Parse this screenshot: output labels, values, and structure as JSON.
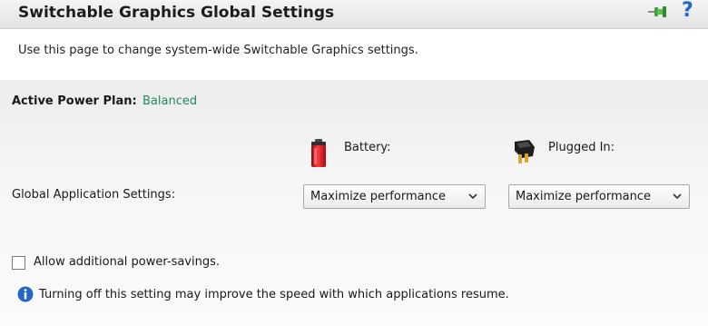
{
  "header": {
    "title": "Switchable Graphics Global Settings",
    "pin_icon": "pin-icon",
    "help_icon": "help-icon",
    "help_glyph": "?"
  },
  "description": "Use this page to change system-wide Switchable Graphics settings.",
  "power_plan": {
    "label": "Active Power Plan:",
    "value": "Balanced",
    "value_color": "#1f8a5c"
  },
  "columns": {
    "battery": {
      "icon": "battery-icon",
      "label": "Battery:"
    },
    "plugged_in": {
      "icon": "plug-icon",
      "label": "Plugged In:"
    }
  },
  "global_settings": {
    "label": "Global Application Settings:",
    "battery_value": "Maximize performance",
    "plugged_value": "Maximize performance"
  },
  "power_savings": {
    "checked": false,
    "label": "Allow additional power-savings."
  },
  "info": {
    "icon": "info-icon",
    "text": "Turning off this setting may improve the speed with which applications resume."
  },
  "colors": {
    "accent_blue": "#2366c9",
    "battery_red": "#d8141a"
  }
}
